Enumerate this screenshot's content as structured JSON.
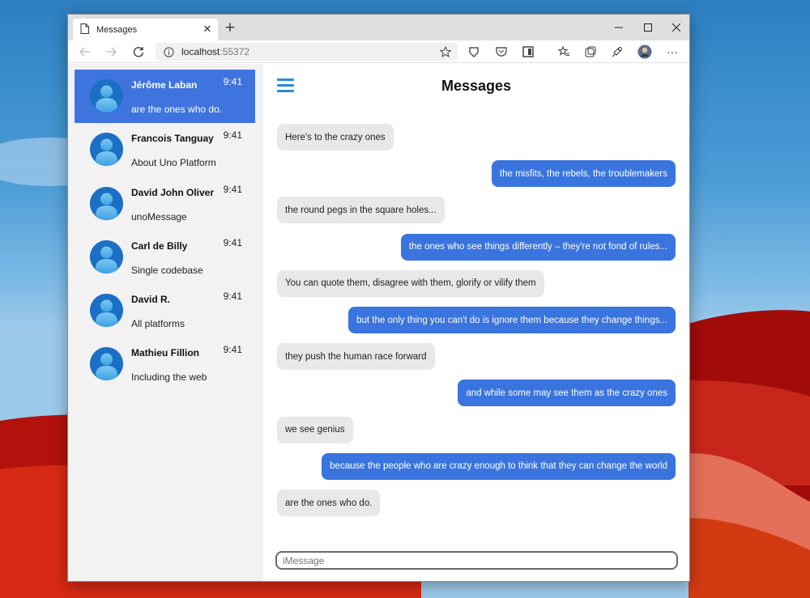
{
  "browser": {
    "tab_title": "Messages",
    "tab_close": "✕",
    "new_tab": "+",
    "minimize": "—",
    "maximize": "☐",
    "close": "✕",
    "url_host": "localhost",
    "url_port": ":55372",
    "more": "···"
  },
  "app": {
    "title": "Messages",
    "composer_placeholder": "iMessage"
  },
  "conversations": [
    {
      "name": "Jérôme Laban",
      "time": "9:41",
      "preview": "are the ones who do.",
      "selected": true
    },
    {
      "name": "Francois Tanguay",
      "time": "9:41",
      "preview": "About Uno Platform",
      "selected": false
    },
    {
      "name": "David John Oliver",
      "time": "9:41",
      "preview": "unoMessage",
      "selected": false
    },
    {
      "name": "Carl de Billy",
      "time": "9:41",
      "preview": "Single codebase",
      "selected": false
    },
    {
      "name": "David R.",
      "time": "9:41",
      "preview": "All platforms",
      "selected": false
    },
    {
      "name": "Mathieu Fillion",
      "time": "9:41",
      "preview": "Including the web",
      "selected": false
    }
  ],
  "messages": [
    {
      "text": "Here's to the crazy ones",
      "direction": "in"
    },
    {
      "text": "the misfits, the rebels, the troublemakers",
      "direction": "out"
    },
    {
      "text": "the round pegs in the square holes...",
      "direction": "in"
    },
    {
      "text": "the ones who see things differently – they're not fond of rules...",
      "direction": "out"
    },
    {
      "text": "You can quote them, disagree with them, glorify or vilify them",
      "direction": "in"
    },
    {
      "text": "but the only thing you can't do is ignore them because they change things...",
      "direction": "out"
    },
    {
      "text": "they push the human race forward",
      "direction": "in"
    },
    {
      "text": "and while some may see them as the crazy ones",
      "direction": "out"
    },
    {
      "text": "we see genius",
      "direction": "in"
    },
    {
      "text": "because the people who are crazy enough to think that they can change the world",
      "direction": "out"
    },
    {
      "text": "are the ones who do.",
      "direction": "in"
    }
  ],
  "colors": {
    "accent": "#3f74df",
    "outgoing_bubble": "#3a74de",
    "incoming_bubble": "#e8e8e8",
    "sidebar_bg": "#f2f2f3"
  }
}
